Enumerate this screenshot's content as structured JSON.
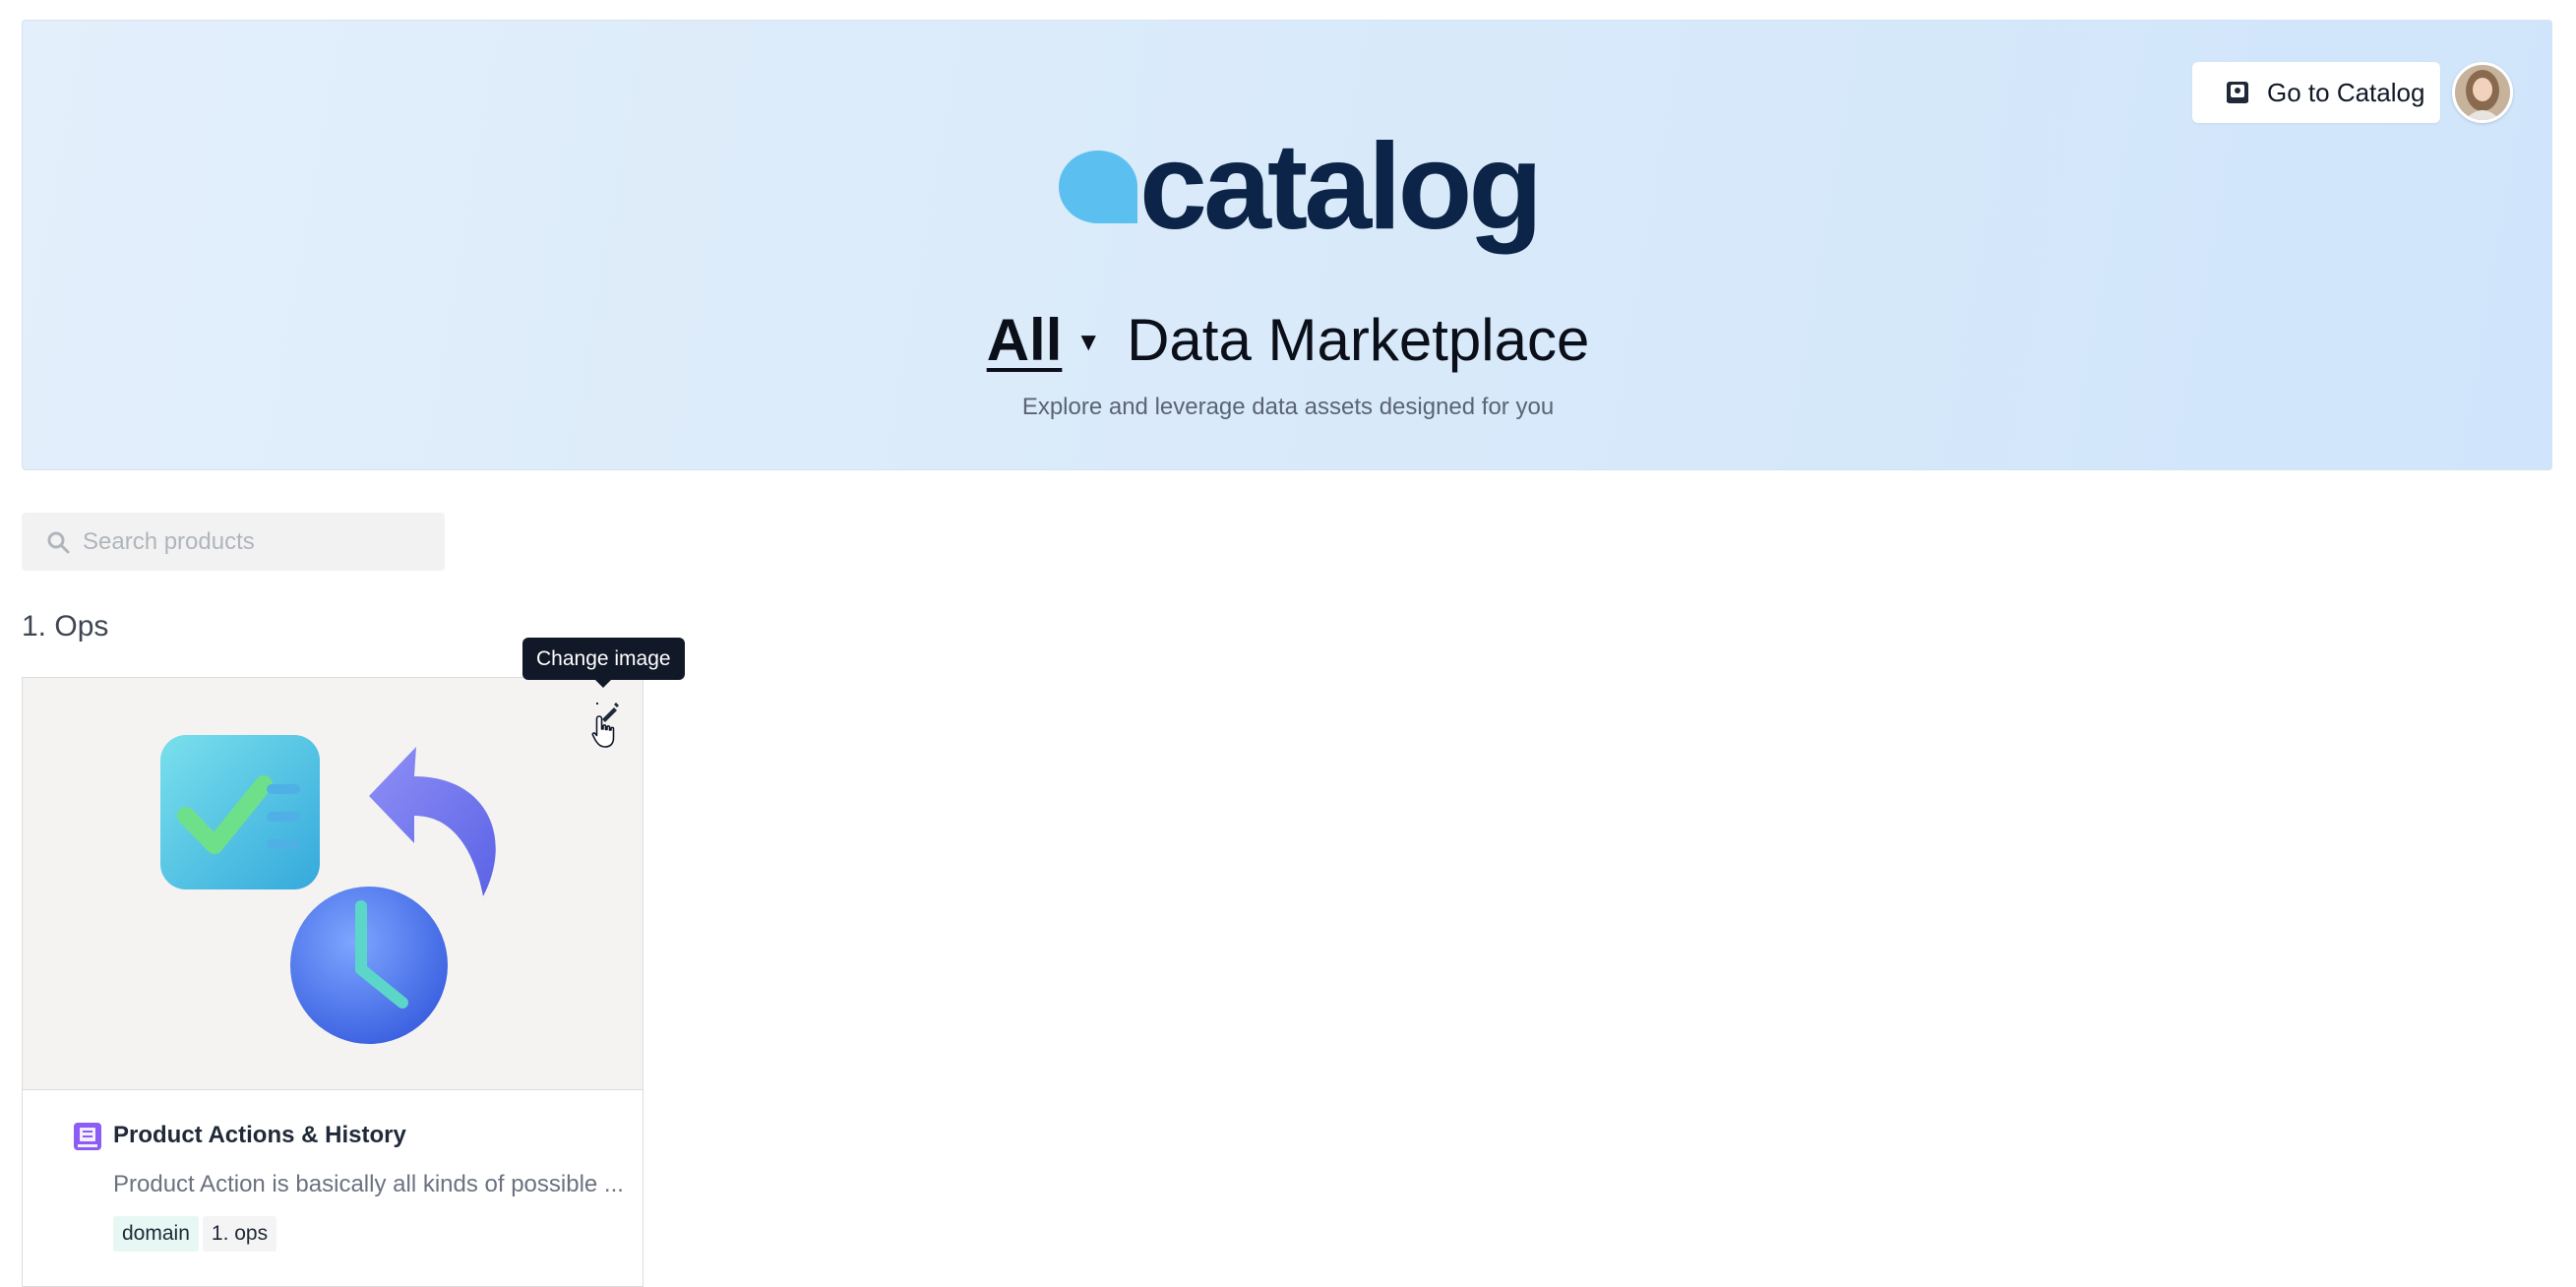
{
  "header": {
    "goto_catalog_label": "Go to Catalog",
    "logo_text": "catalog",
    "scope_label": "All",
    "marketplace_title": "Data Marketplace",
    "subtitle": "Explore and leverage data assets designed for you"
  },
  "search": {
    "placeholder": "Search products"
  },
  "sections": [
    {
      "title": "1. Ops",
      "products": [
        {
          "title": "Product Actions & History",
          "description": "Product Action is basically all kinds of possible ...",
          "tag_key": "domain",
          "tag_value": "1. ops",
          "change_image_tooltip": "Change image"
        }
      ]
    }
  ],
  "colors": {
    "brand_blue": "#5bc0f0",
    "brand_navy": "#0b2447",
    "hero_background": "#dbebfa",
    "tooltip_background": "#111827",
    "product_icon": "#8b5cf6",
    "tag_key_background": "#e6f7f4"
  },
  "icons": {
    "catalog_button": "book-icon",
    "search": "search-icon",
    "scope_dropdown": "caret-down-icon",
    "edit_image": "magic-edit-icon",
    "product": "data-product-book-icon"
  }
}
